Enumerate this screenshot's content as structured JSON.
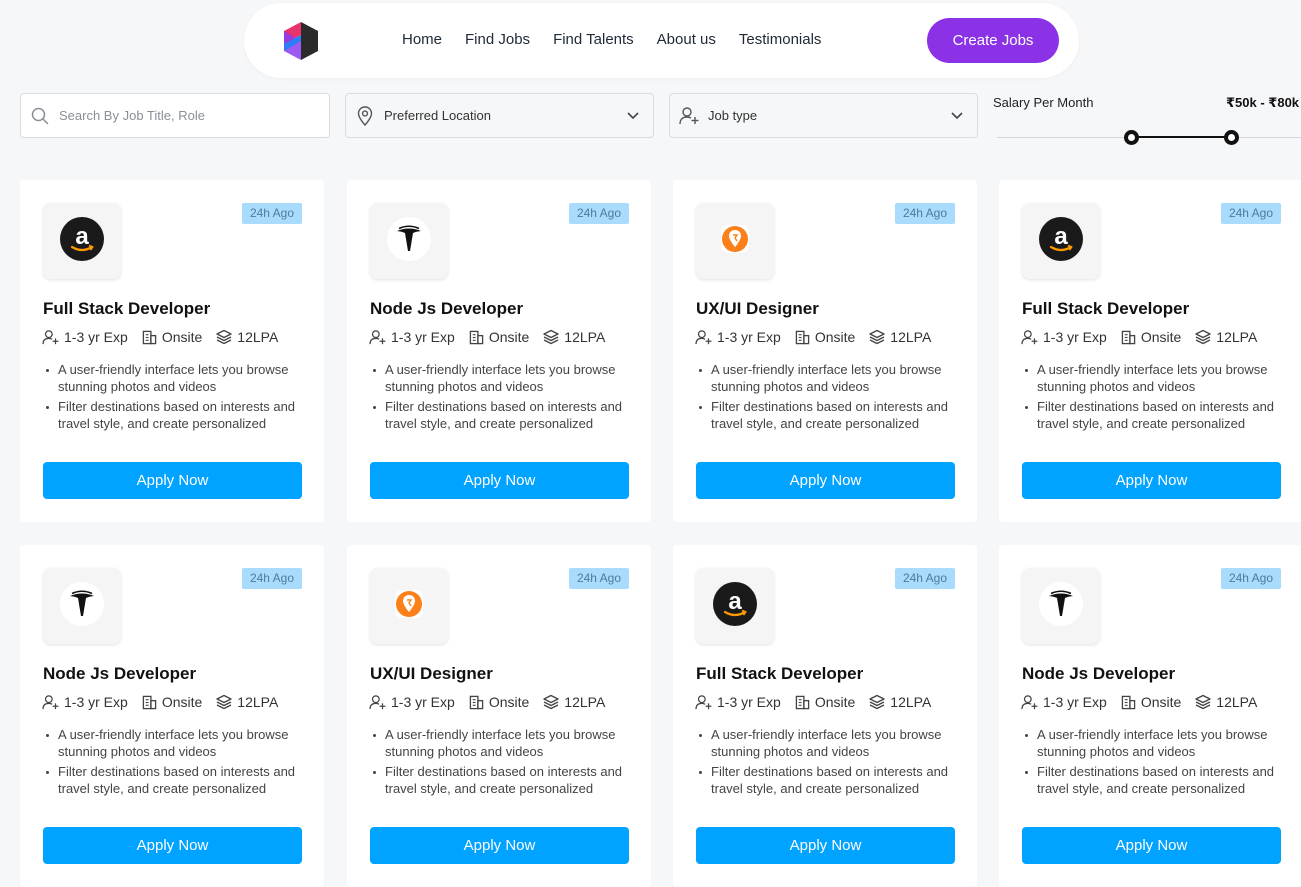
{
  "nav": {
    "links": [
      "Home",
      "Find Jobs",
      "Find Talents",
      "About us",
      "Testimonials"
    ],
    "cta": "Create Jobs",
    "cta_color": "#8b32e6"
  },
  "filters": {
    "search_placeholder": "Search By Job Title, Role",
    "location": "Preferred Location",
    "job_type": "Job type",
    "salary_label": "Salary Per Month",
    "salary_range": "₹50k - ₹80k"
  },
  "colors": {
    "accent": "#00a3ff",
    "badge_bg": "#a9dbfd",
    "badge_text": "#4c7b9f"
  },
  "cards": [
    {
      "logo": "amazon-logo",
      "posted": "24h Ago",
      "title": "Full Stack Developer",
      "experience": "1-3 yr Exp",
      "mode": "Onsite",
      "package": "12LPA",
      "points": [
        "A user-friendly interface lets you browse stunning photos and videos",
        "Filter destinations based on interests and travel style, and create personalized"
      ],
      "apply": "Apply Now"
    },
    {
      "logo": "tesla-logo",
      "posted": "24h Ago",
      "title": "Node Js Developer",
      "experience": "1-3 yr Exp",
      "mode": "Onsite",
      "package": "12LPA",
      "points": [
        "A user-friendly interface lets you browse stunning photos and videos",
        "Filter destinations based on interests and travel style, and create personalized"
      ],
      "apply": "Apply Now"
    },
    {
      "logo": "swiggy-logo",
      "posted": "24h Ago",
      "title": "UX/UI Designer",
      "experience": "1-3 yr Exp",
      "mode": "Onsite",
      "package": "12LPA",
      "points": [
        "A user-friendly interface lets you browse stunning photos and videos",
        "Filter destinations based on interests and travel style, and create personalized"
      ],
      "apply": "Apply Now"
    },
    {
      "logo": "amazon-logo",
      "posted": "24h Ago",
      "title": "Full Stack Developer",
      "experience": "1-3 yr Exp",
      "mode": "Onsite",
      "package": "12LPA",
      "points": [
        "A user-friendly interface lets you browse stunning photos and videos",
        "Filter destinations based on interests and travel style, and create personalized"
      ],
      "apply": "Apply Now"
    },
    {
      "logo": "tesla-logo",
      "posted": "24h Ago",
      "title": "Node Js Developer",
      "experience": "1-3 yr Exp",
      "mode": "Onsite",
      "package": "12LPA",
      "points": [
        "A user-friendly interface lets you browse stunning photos and videos",
        "Filter destinations based on interests and travel style, and create personalized"
      ],
      "apply": "Apply Now"
    },
    {
      "logo": "swiggy-logo",
      "posted": "24h Ago",
      "title": "UX/UI Designer",
      "experience": "1-3 yr Exp",
      "mode": "Onsite",
      "package": "12LPA",
      "points": [
        "A user-friendly interface lets you browse stunning photos and videos",
        "Filter destinations based on interests and travel style, and create personalized"
      ],
      "apply": "Apply Now"
    },
    {
      "logo": "amazon-logo",
      "posted": "24h Ago",
      "title": "Full Stack Developer",
      "experience": "1-3 yr Exp",
      "mode": "Onsite",
      "package": "12LPA",
      "points": [
        "A user-friendly interface lets you browse stunning photos and videos",
        "Filter destinations based on interests and travel style, and create personalized"
      ],
      "apply": "Apply Now"
    },
    {
      "logo": "tesla-logo",
      "posted": "24h Ago",
      "title": "Node Js Developer",
      "experience": "1-3 yr Exp",
      "mode": "Onsite",
      "package": "12LPA",
      "points": [
        "A user-friendly interface lets you browse stunning photos and videos",
        "Filter destinations based on interests and travel style, and create personalized"
      ],
      "apply": "Apply Now"
    }
  ]
}
